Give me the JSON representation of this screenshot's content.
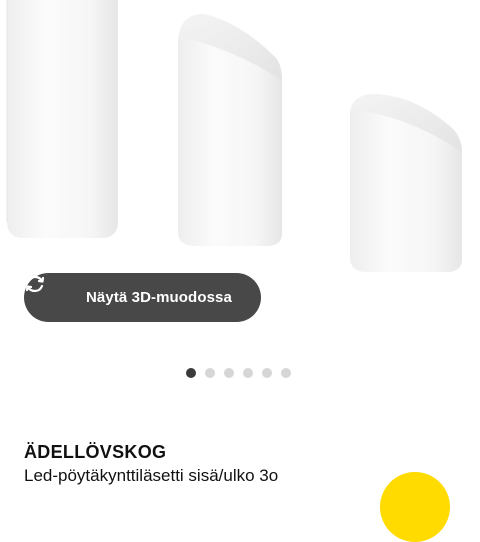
{
  "gallery": {
    "button_label": "Näytä 3D-muodossa",
    "button_icon": "rotate-3d-icon",
    "dots": [
      {
        "active": true
      },
      {
        "active": false
      },
      {
        "active": false
      },
      {
        "active": false
      },
      {
        "active": false
      },
      {
        "active": false
      }
    ]
  },
  "product": {
    "name": "ÄDELLÖVSKOG",
    "description": "Led-pöytäkynttiläsetti sisä/ulko 3o"
  },
  "colors": {
    "button_bg": "#484848",
    "dot_active": "#3a3a3a",
    "dot_inactive": "#d6d6d6",
    "badge": "#ffdb00"
  }
}
